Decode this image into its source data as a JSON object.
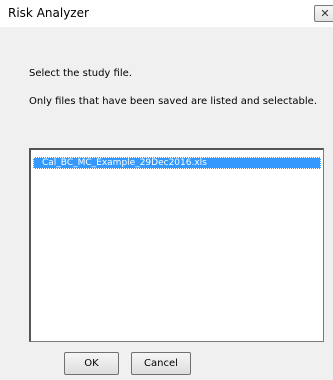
{
  "window": {
    "title": "Risk Analyzer",
    "close_glyph": "✕"
  },
  "content": {
    "prompt": "Select the study file.",
    "note": "Only files that have been saved are listed and selectable."
  },
  "file_list": {
    "items": [
      {
        "label": "Cal_BC_MC_Example_29Dec2016.xls",
        "selected": true
      }
    ]
  },
  "buttons": {
    "ok_label": "OK",
    "cancel_label": "Cancel"
  },
  "colors": {
    "selection": "#3399ff",
    "dialog_bg": "#f0f0f0"
  }
}
